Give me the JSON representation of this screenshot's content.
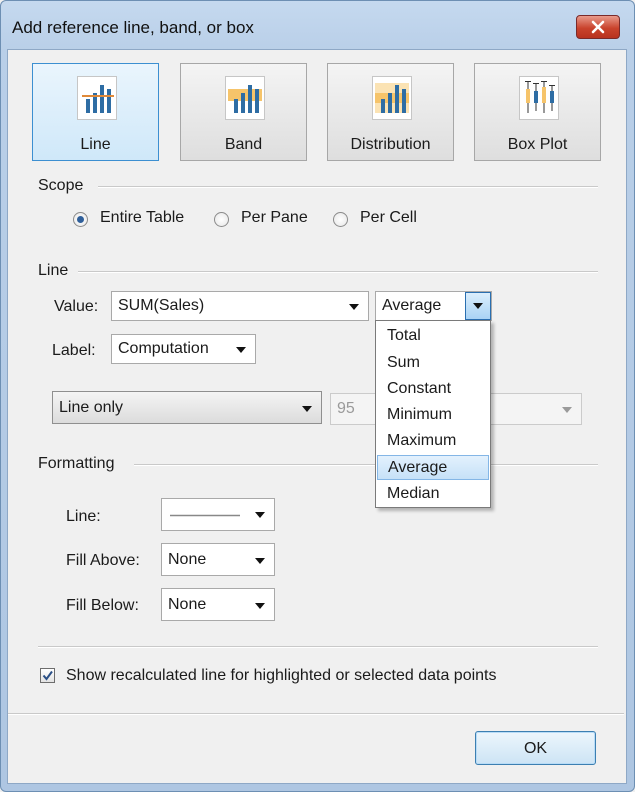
{
  "window": {
    "title": "Add reference line, band, or box"
  },
  "types": [
    {
      "label": "Line",
      "icon": "reference-line-icon",
      "selected": true
    },
    {
      "label": "Band",
      "icon": "reference-band-icon",
      "selected": false
    },
    {
      "label": "Distribution",
      "icon": "distribution-icon",
      "selected": false
    },
    {
      "label": "Box Plot",
      "icon": "box-plot-icon",
      "selected": false
    }
  ],
  "scope": {
    "title": "Scope",
    "options": [
      "Entire Table",
      "Per Pane",
      "Per Cell"
    ],
    "selected": "Entire Table"
  },
  "line": {
    "title": "Line",
    "value_label": "Value:",
    "value_field": "SUM(Sales)",
    "aggregation": "Average",
    "aggregation_options": [
      "Total",
      "Sum",
      "Constant",
      "Minimum",
      "Maximum",
      "Average",
      "Median"
    ],
    "label_label": "Label:",
    "label_value": "Computation",
    "confidence_mode": "Line only",
    "confidence_value": "95"
  },
  "formatting": {
    "title": "Formatting",
    "line_label": "Line:",
    "fill_above_label": "Fill Above:",
    "fill_above_value": "None",
    "fill_below_label": "Fill Below:",
    "fill_below_value": "None"
  },
  "recalc": {
    "label": "Show recalculated line for highlighted or selected data points",
    "checked": true
  },
  "ok_label": "OK",
  "colors": {
    "accent_blue": "#3c8fd1",
    "close_red": "#c9432d",
    "bar_blue": "#2e6da4",
    "band_orange": "#f6c46a"
  }
}
